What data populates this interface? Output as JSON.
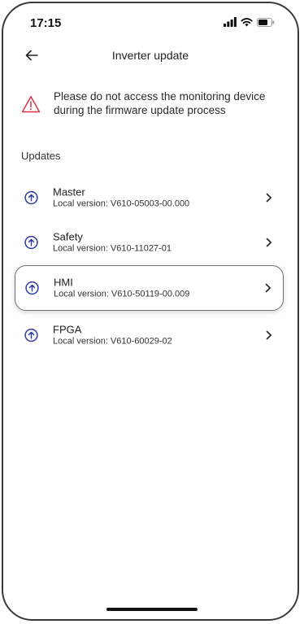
{
  "status_bar": {
    "time": "17:15"
  },
  "nav": {
    "title": "Inverter update",
    "back_icon": "arrow-left-icon"
  },
  "warning": {
    "icon": "warning-triangle-icon",
    "color": "#d6334a",
    "line1": "Please do not access the monitoring device",
    "line2": "during the firmware update process"
  },
  "updates": {
    "section_title": "Updates",
    "accent_color": "#2f3a9e",
    "items": [
      {
        "name": "Master",
        "version": "Local version: V610-05003-00.000",
        "highlighted": false
      },
      {
        "name": "Safety",
        "version": "Local version: V610-11027-01",
        "highlighted": false
      },
      {
        "name": "HMI",
        "version": "Local version: V610-50119-00.009",
        "highlighted": true
      },
      {
        "name": "FPGA",
        "version": "Local version: V610-60029-02",
        "highlighted": false
      }
    ]
  }
}
